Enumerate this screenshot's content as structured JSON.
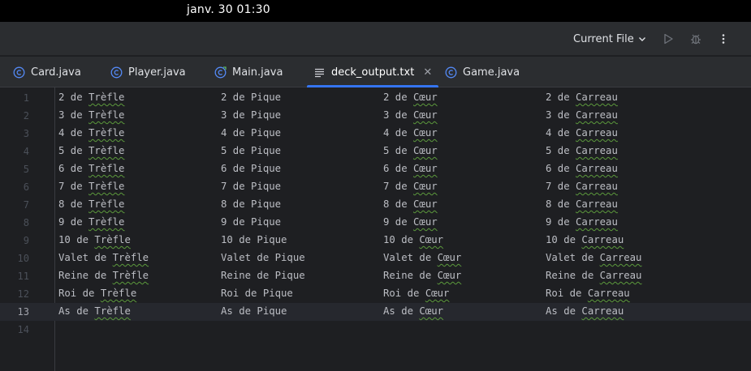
{
  "system": {
    "clock": "janv. 30  01:30"
  },
  "toolbar": {
    "run_config": "Current File"
  },
  "tabs": [
    {
      "label": "Card.java",
      "icon": "class-icon",
      "active": false
    },
    {
      "label": "Player.java",
      "icon": "class-icon",
      "active": false
    },
    {
      "label": "Main.java",
      "icon": "main-class-icon",
      "active": false
    },
    {
      "label": "deck_output.txt",
      "icon": "text-file-icon",
      "active": true
    },
    {
      "label": "Game.java",
      "icon": "class-icon",
      "active": false
    }
  ],
  "editor": {
    "current_line": 13,
    "line_numbers": [
      "1",
      "2",
      "3",
      "4",
      "5",
      "6",
      "7",
      "8",
      "9",
      "10",
      "11",
      "12",
      "13",
      "14"
    ],
    "rows": [
      [
        [
          "2 de ",
          "Trèfle"
        ],
        [
          "2 de Pique",
          ""
        ],
        [
          "2 de ",
          "Cœur"
        ],
        [
          "2 de ",
          "Carreau"
        ]
      ],
      [
        [
          "3 de ",
          "Trèfle"
        ],
        [
          "3 de Pique",
          ""
        ],
        [
          "3 de ",
          "Cœur"
        ],
        [
          "3 de ",
          "Carreau"
        ]
      ],
      [
        [
          "4 de ",
          "Trèfle"
        ],
        [
          "4 de Pique",
          ""
        ],
        [
          "4 de ",
          "Cœur"
        ],
        [
          "4 de ",
          "Carreau"
        ]
      ],
      [
        [
          "5 de ",
          "Trèfle"
        ],
        [
          "5 de Pique",
          ""
        ],
        [
          "5 de ",
          "Cœur"
        ],
        [
          "5 de ",
          "Carreau"
        ]
      ],
      [
        [
          "6 de ",
          "Trèfle"
        ],
        [
          "6 de Pique",
          ""
        ],
        [
          "6 de ",
          "Cœur"
        ],
        [
          "6 de ",
          "Carreau"
        ]
      ],
      [
        [
          "7 de ",
          "Trèfle"
        ],
        [
          "7 de Pique",
          ""
        ],
        [
          "7 de ",
          "Cœur"
        ],
        [
          "7 de ",
          "Carreau"
        ]
      ],
      [
        [
          "8 de ",
          "Trèfle"
        ],
        [
          "8 de Pique",
          ""
        ],
        [
          "8 de ",
          "Cœur"
        ],
        [
          "8 de ",
          "Carreau"
        ]
      ],
      [
        [
          "9 de ",
          "Trèfle"
        ],
        [
          "9 de Pique",
          ""
        ],
        [
          "9 de ",
          "Cœur"
        ],
        [
          "9 de ",
          "Carreau"
        ]
      ],
      [
        [
          "10 de ",
          "Trèfle"
        ],
        [
          "10 de Pique",
          ""
        ],
        [
          "10 de ",
          "Cœur"
        ],
        [
          "10 de ",
          "Carreau"
        ]
      ],
      [
        [
          "Valet de ",
          "Trèfle"
        ],
        [
          "Valet de Pique",
          ""
        ],
        [
          "Valet de ",
          "Cœur"
        ],
        [
          "Valet de ",
          "Carreau"
        ]
      ],
      [
        [
          "Reine de ",
          "Trèfle"
        ],
        [
          "Reine de Pique",
          ""
        ],
        [
          "Reine de ",
          "Cœur"
        ],
        [
          "Reine de ",
          "Carreau"
        ]
      ],
      [
        [
          "Roi de ",
          "Trèfle"
        ],
        [
          "Roi de Pique",
          ""
        ],
        [
          "Roi de ",
          "Cœur"
        ],
        [
          "Roi de ",
          "Carreau"
        ]
      ],
      [
        [
          "As de ",
          "Trèfle"
        ],
        [
          "As de Pique",
          ""
        ],
        [
          "As de ",
          "Cœur"
        ],
        [
          "As de ",
          "Carreau"
        ]
      ]
    ]
  },
  "colors": {
    "accent": "#3574f0",
    "typo_underline": "#5c9a3c"
  }
}
